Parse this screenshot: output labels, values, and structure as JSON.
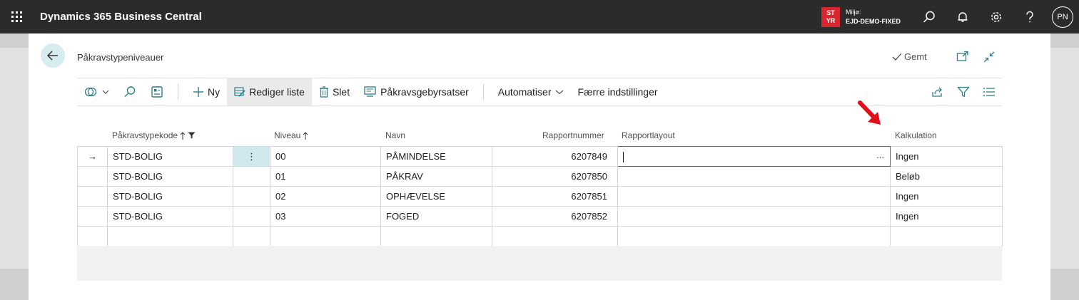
{
  "app": {
    "title": "Dynamics 365 Business Central"
  },
  "environment": {
    "badge_line1": "ST",
    "badge_line2": "YR",
    "label": "Miljø:",
    "name": "EJD-DEMO-FIXED"
  },
  "user": {
    "initials": "PN"
  },
  "page": {
    "title": "Påkravstypeniveauer",
    "saved_label": "Gemt"
  },
  "toolbar": {
    "new_label": "Ny",
    "edit_list_label": "Rediger liste",
    "delete_label": "Slet",
    "fee_rates_label": "Påkravsgebyrsatser",
    "automate_label": "Automatiser",
    "fewer_options_label": "Færre indstillinger"
  },
  "grid": {
    "columns": {
      "type_code": "Påkravstypekode",
      "level": "Niveau",
      "name": "Navn",
      "report_number": "Rapportnummer",
      "report_layout": "Rapportlayout",
      "calculation": "Kalkulation"
    },
    "rows": [
      {
        "type_code": "STD-BOLIG",
        "level": "00",
        "name": "PÅMINDELSE",
        "report_number": "6207849",
        "report_layout": "",
        "calculation": "Ingen"
      },
      {
        "type_code": "STD-BOLIG",
        "level": "01",
        "name": "PÅKRAV",
        "report_number": "6207850",
        "report_layout": "",
        "calculation": "Beløb"
      },
      {
        "type_code": "STD-BOLIG",
        "level": "02",
        "name": "OPHÆVELSE",
        "report_number": "6207851",
        "report_layout": "",
        "calculation": "Ingen"
      },
      {
        "type_code": "STD-BOLIG",
        "level": "03",
        "name": "FOGED",
        "report_number": "6207852",
        "report_layout": "",
        "calculation": "Ingen"
      }
    ],
    "dots_glyph": "⋮",
    "ellipsis_glyph": "...",
    "row_arrow_glyph": "→"
  },
  "colors": {
    "topbar": "#2b2b2b",
    "accent": "#2e7d88",
    "badge": "#d9262e",
    "annotation_arrow": "#e0101a"
  }
}
